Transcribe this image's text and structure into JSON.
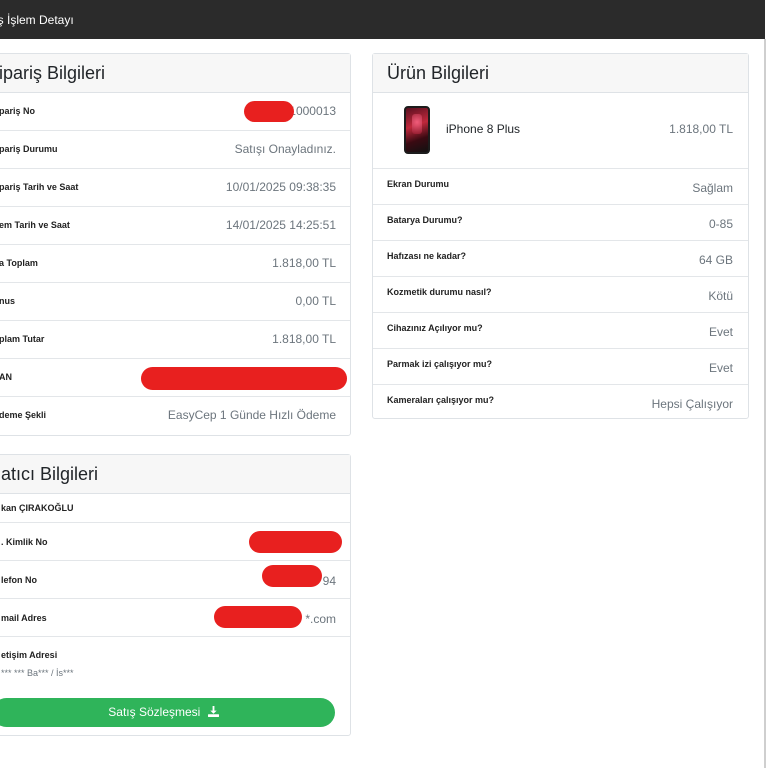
{
  "topbar": {
    "title": "iş İşlem Detayı"
  },
  "order": {
    "title": "ipariş Bilgileri",
    "rows": [
      {
        "label": "pariş No",
        "value": "1000013"
      },
      {
        "label": "pariş Durumu",
        "value": "Satışı Onayladınız."
      },
      {
        "label": "pariş Tarih ve Saat",
        "value": "10/01/2025 09:38:35"
      },
      {
        "label": "em Tarih ve Saat",
        "value": "14/01/2025 14:25:51"
      },
      {
        "label": "a Toplam",
        "value": "1.818,00 TL"
      },
      {
        "label": "nus",
        "value": "0,00 TL"
      },
      {
        "label": "plam Tutar",
        "value": "1.818,00 TL"
      },
      {
        "label": "AN",
        "value": ""
      },
      {
        "label": "deme Şekli",
        "value": "EasyCep 1 Günde Hızlı Ödeme"
      }
    ]
  },
  "seller": {
    "title": "atıcı Bilgileri",
    "name": "kan ÇIRAKOĞLU",
    "rows": [
      {
        "label": ". Kimlik No",
        "value": ""
      },
      {
        "label": "lefon No",
        "value": "94"
      },
      {
        "label": "mail Adres",
        "value": "*.com",
        "prefix": "a"
      },
      {
        "label": "etişim Adresi",
        "value": ""
      }
    ],
    "address_line": "*** *** Ba*** / İs***",
    "contract_button": "Satış Sözleşmesi",
    "contract_icon": "download-icon"
  },
  "product": {
    "title": "Ürün Bilgileri",
    "name": "iPhone 8 Plus",
    "price": "1.818,00 TL",
    "rows": [
      {
        "label": "Ekran Durumu",
        "value": "Sağlam"
      },
      {
        "label": "Batarya Durumu?",
        "value": "0-85"
      },
      {
        "label": "Hafızası ne kadar?",
        "value": "64 GB"
      },
      {
        "label": "Kozmetik durumu nasıl?",
        "value": "Kötü"
      },
      {
        "label": "Cihazınız Açılıyor mu?",
        "value": "Evet"
      },
      {
        "label": "Parmak izi çalışıyor mu?",
        "value": "Evet"
      },
      {
        "label": "Kameraları çalışıyor mu?",
        "value": "Hepsi Çalışıyor"
      }
    ]
  },
  "colors": {
    "topbar": "#2b2b2b",
    "button": "#2fb45a",
    "redaction": "#e8201f"
  }
}
